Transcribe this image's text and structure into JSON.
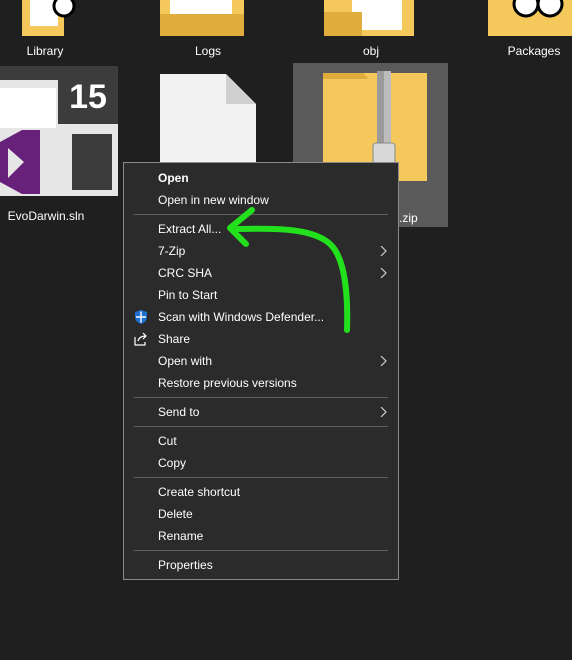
{
  "desktop": {
    "top_labels": [
      "Library",
      "Logs",
      "obj",
      "Packages"
    ],
    "sln_label": "EvoDarwin.sln",
    "vs_version": "15",
    "zip_label_suffix": ".zip"
  },
  "menu": {
    "open": "Open",
    "open_new_window": "Open in new window",
    "extract_all": "Extract All...",
    "seven_zip": "7-Zip",
    "crc_sha": "CRC SHA",
    "pin_to_start": "Pin to Start",
    "scan_defender": "Scan with Windows Defender...",
    "share": "Share",
    "open_with": "Open with",
    "restore_versions": "Restore previous versions",
    "send_to": "Send to",
    "cut": "Cut",
    "copy": "Copy",
    "create_shortcut": "Create shortcut",
    "delete": "Delete",
    "rename": "Rename",
    "properties": "Properties"
  },
  "colors": {
    "background": "#1f1f1f",
    "menu_bg": "#2b2b2b",
    "menu_border": "#8a8a8a",
    "separator": "#5e5e5e",
    "folder": "#f4c85a",
    "folder_dark": "#e0ad3c",
    "vs_purple": "#68217a",
    "annotation_arrow": "#22e01c",
    "zip_selection": "#5a5a5a"
  }
}
